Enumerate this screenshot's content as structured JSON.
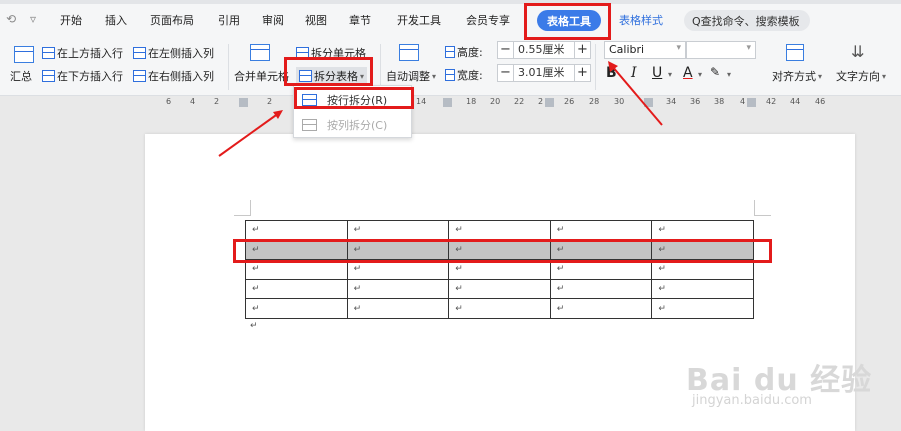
{
  "quick_access": {
    "undo": "⟲",
    "dropdown": "▿"
  },
  "tabs": [
    "开始",
    "插入",
    "页面布局",
    "引用",
    "审阅",
    "视图",
    "章节",
    "开发工具",
    "会员专享",
    "表格工具",
    "表格样式"
  ],
  "search_placeholder": "Q查找命令、搜索模板",
  "ribbon": {
    "insert_above": "在上方插入行",
    "insert_left": "在左侧插入列",
    "insert_below": "在下方插入行",
    "insert_right": "在右侧插入列",
    "summary": "汇总",
    "merge_cells": "合并单元格",
    "split_cells": "拆分单元格",
    "split_table": "拆分表格",
    "auto_fit": "自动调整",
    "height_label": "高度:",
    "height_value": "0.55厘米",
    "width_label": "宽度:",
    "width_value": "3.01厘米",
    "font_name": "Calibri",
    "font_size": "",
    "align": "对齐方式",
    "text_direction": "文字方向",
    "bold": "B",
    "italic": "I",
    "underline": "U",
    "font_color": "A"
  },
  "ruler_ticks": [
    "6",
    "4",
    "2",
    "2",
    "14",
    "18",
    "20",
    "22",
    "2",
    "26",
    "28",
    "30",
    "34",
    "36",
    "38",
    "4",
    "42",
    "44",
    "46"
  ],
  "dropdown": {
    "split_by_row": "按行拆分(R)",
    "split_by_column": "按列拆分(C)"
  },
  "table": {
    "rows": 5,
    "cols": 5,
    "cell_mark": "↵",
    "selected_row": 2
  },
  "watermark": {
    "main": "Bai du 经验",
    "sub": "jingyan.baidu.com"
  },
  "colors": {
    "accent": "#3b7be8",
    "highlight": "#e31b1b",
    "selected_row": "#c4c4c4"
  }
}
